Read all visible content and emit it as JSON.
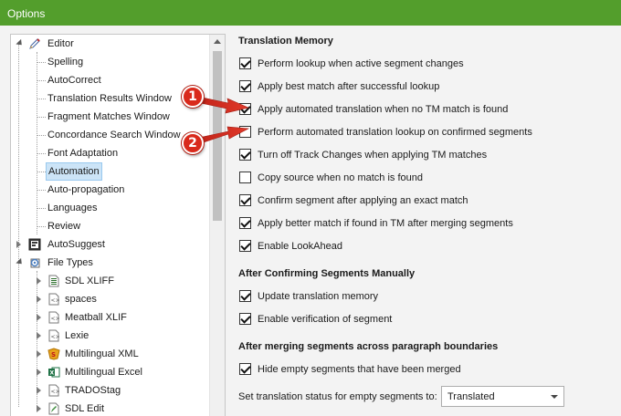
{
  "window": {
    "title": "Options"
  },
  "tree": {
    "editor": "Editor",
    "editor_children": [
      "Spelling",
      "AutoCorrect",
      "Translation Results Window",
      "Fragment Matches Window",
      "Concordance Search Window",
      "Font Adaptation",
      "Automation",
      "Auto-propagation",
      "Languages",
      "Review"
    ],
    "selected": "Automation",
    "autosuggest": "AutoSuggest",
    "file_types": "File Types",
    "file_type_children": [
      "SDL XLIFF",
      "spaces",
      "Meatball XLIF",
      "Lexie",
      "Multilingual XML",
      "Multilingual Excel",
      "TRADOStag",
      "SDL Edit"
    ]
  },
  "sections": {
    "tm": {
      "heading": "Translation Memory",
      "options": [
        {
          "label": "Perform lookup when active segment changes",
          "checked": true
        },
        {
          "label": "Apply best match after successful lookup",
          "checked": true
        },
        {
          "label": "Apply automated translation when no TM match is found",
          "checked": true
        },
        {
          "label": "Perform automated translation lookup on confirmed segments",
          "checked": false
        },
        {
          "label": "Turn off Track Changes when applying TM matches",
          "checked": true
        },
        {
          "label": "Copy source when no match is found",
          "checked": false
        },
        {
          "label": "Confirm segment after applying an exact match",
          "checked": true
        },
        {
          "label": "Apply better match if found in TM after merging segments",
          "checked": true
        },
        {
          "label": "Enable LookAhead",
          "checked": true
        }
      ]
    },
    "confirm": {
      "heading": "After Confirming Segments Manually",
      "options": [
        {
          "label": "Update translation memory",
          "checked": true
        },
        {
          "label": "Enable verification of segment",
          "checked": true
        }
      ]
    },
    "merge": {
      "heading": "After merging segments across paragraph boundaries",
      "options": [
        {
          "label": "Hide empty segments that have been merged",
          "checked": true
        }
      ],
      "status_label": "Set translation status for empty segments to:",
      "status_value": "Translated"
    }
  },
  "callouts": [
    "1",
    "2"
  ],
  "colors": {
    "titlebar": "#539e2c",
    "callout": "#d92a1c",
    "selection": "#cce4f7"
  },
  "icons": [
    "expand-arrow-icon",
    "collapse-arrow-icon",
    "pencil-icon",
    "autosuggest-icon",
    "file-types-icon",
    "xliff-file-icon",
    "tag-file-icon",
    "xml-file-icon",
    "excel-file-icon",
    "edit-file-icon",
    "scroll-up-icon",
    "dropdown-arrow-icon"
  ]
}
